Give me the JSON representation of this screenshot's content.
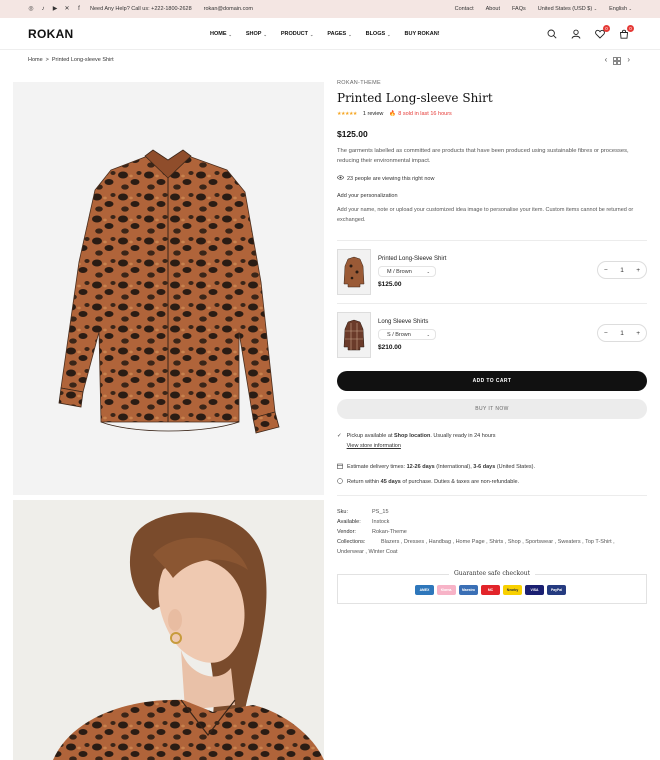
{
  "topbar": {
    "social_icons": [
      "instagram-icon",
      "tiktok-icon",
      "youtube-icon",
      "x-icon",
      "facebook-icon"
    ],
    "help": "Need Any Help? Call us: +222-1800-2628",
    "email": "rokan@domain.com",
    "links": [
      "Contact",
      "About",
      "FAQs"
    ],
    "currency": "United States (USD $)",
    "language": "English"
  },
  "header": {
    "logo": "ROKAN",
    "nav": [
      "HOME",
      "SHOP",
      "PRODUCT",
      "PAGES",
      "BLOGS",
      "BUY ROKAN!"
    ],
    "wishlist_count": "0",
    "cart_count": "0"
  },
  "breadcrumb": {
    "home": "Home",
    "sep": ">",
    "current": "Printed Long-sleeve Shirt"
  },
  "product": {
    "vendor": "ROKAN-THEME",
    "title": "Printed Long-sleeve Shirt",
    "stars": "★★★★★",
    "reviews": "1 review",
    "sold": "8 sold in last 16 hours",
    "price": "$125.00",
    "description": "The garments labelled as committed are products that have been produced using sustainable fibres or processes, reducing their environmental impact.",
    "viewing": "23 people are viewing this right now",
    "personalization_title": "Add your personalization",
    "personalization_desc": "Add your name, note or upload your customized idea image to personalise your item. Custom items cannot be returned or exchanged."
  },
  "bundle": [
    {
      "name": "Printed Long-Sleeve Shirt",
      "variant": "M / Brown",
      "price": "$125.00",
      "qty": "1"
    },
    {
      "name": "Long Sleeve Shirts",
      "variant": "S / Brown",
      "price": "$210.00",
      "qty": "1"
    }
  ],
  "buttons": {
    "add_to_cart": "ADD TO CART",
    "buy_now": "BUY IT NOW"
  },
  "pickup": {
    "prefix": "Pickup available at ",
    "location": "Shop location",
    "suffix": ". Usually ready in 24 hours",
    "link": "View store information"
  },
  "delivery": {
    "estimate_prefix": "Estimate delivery times: ",
    "estimate_intl": "12-26 days",
    "estimate_mid": " (International), ",
    "estimate_us": "3-6 days",
    "estimate_suffix": " (United States).",
    "return_prefix": "Return within ",
    "return_days": "45 days",
    "return_suffix": " of purchase. Duties & taxes are non-refundable."
  },
  "meta": {
    "sku_label": "Sku:",
    "sku": "PS_15",
    "available_label": "Available:",
    "available": "Instock",
    "vendor_label": "Vendor:",
    "vendor": "Rokan-Theme",
    "collections_label": "Collections:",
    "collections": "Blazers , Dresses , Handbag , Home Page , Shirts , Shop , Sportswear , Sweaters , Top T-Shirt ,",
    "collections_line2": "Underwear , Winter Coat"
  },
  "guarantee": {
    "label": "Guarantee safe checkout",
    "methods": [
      {
        "name": "AMEX",
        "color": "#2e77bb"
      },
      {
        "name": "Klarna.",
        "color": "#f7b3c7"
      },
      {
        "name": "Maestro",
        "color": "#3a6fb5"
      },
      {
        "name": "MC",
        "color": "#e2242a"
      },
      {
        "name": "Nearby",
        "color": "#f8d000"
      },
      {
        "name": "VISA",
        "color": "#1a1f71"
      },
      {
        "name": "PayPal",
        "color": "#253b80"
      }
    ]
  }
}
